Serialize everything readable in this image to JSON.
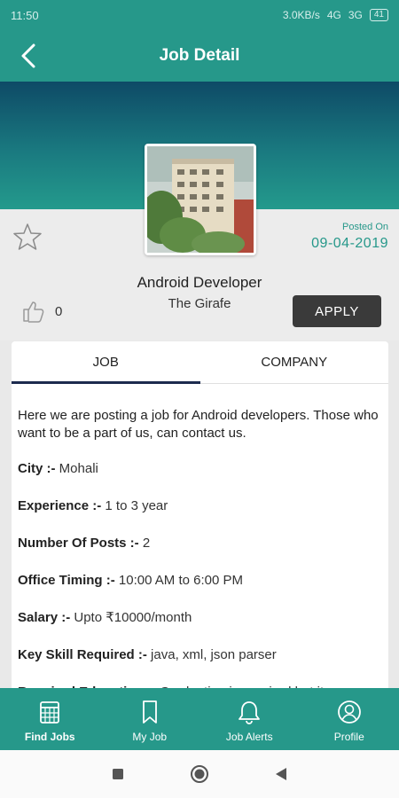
{
  "status_bar": {
    "time": "11:50",
    "speed": "3.0KB/s",
    "net1": "4G",
    "net2": "3G",
    "battery": "41"
  },
  "header": {
    "title": "Job Detail"
  },
  "job": {
    "posted_label": "Posted On",
    "posted_date": "09-04-2019",
    "title": "Android Developer",
    "company": "The Girafe",
    "likes": "0",
    "apply_label": "APPLY"
  },
  "tabs": [
    {
      "label": "JOB",
      "active": true
    },
    {
      "label": "COMPANY",
      "active": false
    }
  ],
  "details": {
    "description": "Here we are posting a job for Android developers.  Those who want to be a part of us, can contact us.",
    "fields": [
      {
        "label": "City :-",
        "value": "Mohali"
      },
      {
        "label": "Experience :-",
        "value": "1 to 3 year"
      },
      {
        "label": "Number Of Posts :-",
        "value": "2"
      },
      {
        "label": "Office Timing :-",
        "value": "10:00 AM to 6:00 PM"
      },
      {
        "label": "Salary :-",
        "value": "Upto ₹10000/month"
      },
      {
        "label": "Key Skill Required :-",
        "value": "java, xml, json parser"
      },
      {
        "label": "Required Education :-",
        "value": "Graduation is required but it"
      }
    ]
  },
  "bottom_nav": [
    {
      "label": "Find Jobs",
      "icon": "briefcase-icon",
      "active": true
    },
    {
      "label": "My Job",
      "icon": "bookmark-icon",
      "active": false
    },
    {
      "label": "Job Alerts",
      "icon": "bell-icon",
      "active": false
    },
    {
      "label": "Profile",
      "icon": "profile-icon",
      "active": false
    }
  ],
  "colors": {
    "primary": "#26988a",
    "banner_top": "#0e4a66",
    "apply": "#3a3a3a",
    "tab_indicator": "#1d2b4f"
  }
}
